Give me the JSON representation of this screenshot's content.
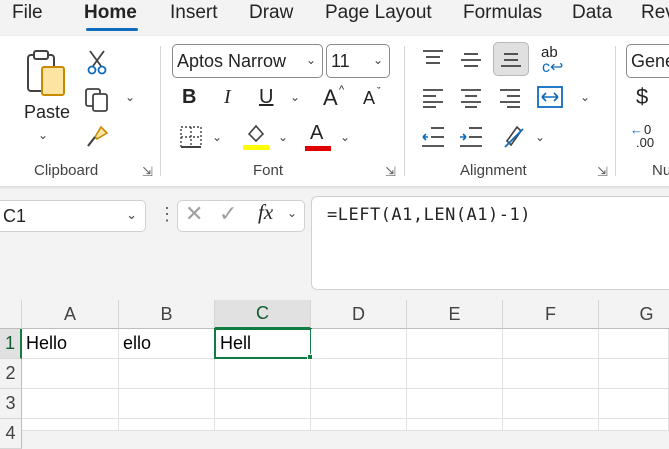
{
  "tabs": {
    "file": "File",
    "home": "Home",
    "insert": "Insert",
    "draw": "Draw",
    "page_layout": "Page Layout",
    "formulas": "Formulas",
    "data": "Data",
    "review": "Rev"
  },
  "clipboard": {
    "paste_label": "Paste",
    "group_label": "Clipboard"
  },
  "font": {
    "font_name": "Aptos Narrow",
    "font_size": "11",
    "bold": "B",
    "italic": "I",
    "underline": "U",
    "grow": "A",
    "shrink": "A",
    "font_color_letter": "A",
    "group_label": "Font",
    "fill_color": "#ffff00",
    "font_color": "#e00000"
  },
  "alignment": {
    "wrap_text": "ab",
    "group_label": "Alignment"
  },
  "number": {
    "format": "Gene",
    "currency": "$",
    "group_label_partial": "Nu"
  },
  "formula_bar": {
    "name_box": "C1",
    "fx": "fx",
    "formula": "=LEFT(A1,LEN(A1)-1)"
  },
  "sheet": {
    "columns": [
      "A",
      "B",
      "C",
      "D",
      "E",
      "F",
      "G"
    ],
    "rows": [
      "1",
      "2",
      "3",
      "4"
    ],
    "cells": {
      "A1": "Hello",
      "B1": "ello",
      "C1": "Hell"
    },
    "active_cell": "C1",
    "accent_color": "#107c41"
  }
}
